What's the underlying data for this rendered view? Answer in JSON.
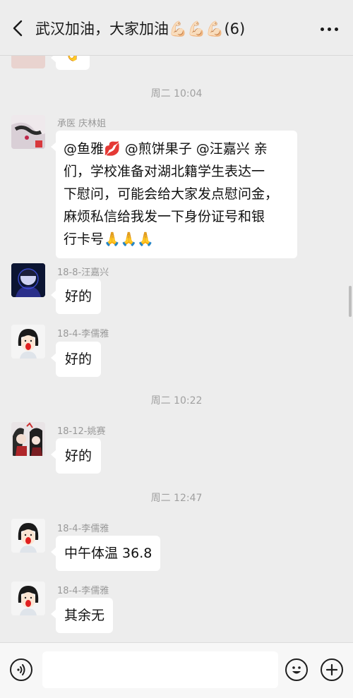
{
  "header": {
    "title": "武汉加油，大家加油💪🏻💪🏻💪🏻(6)"
  },
  "messages": {
    "partial_top": {
      "text": "👌"
    },
    "time1": "周二 10:04",
    "m1": {
      "sender": "承医 庆林姐",
      "line1": "@鱼雅💋 @煎饼果子 @汪嘉兴  亲",
      "line2": "们，学校准备对湖北籍学生表达一",
      "line3": "下慰问，可能会给大家发点慰问金，",
      "line4": "麻烦私信给我发一下身份证号和银",
      "line5": "行卡号🙏🙏🙏"
    },
    "m2": {
      "sender": "18-8-汪嘉兴",
      "text": "好的"
    },
    "m3": {
      "sender": "18-4-李儒雅",
      "text": "好的"
    },
    "time2": "周二 10:22",
    "m4": {
      "sender": "18-12-姚赛",
      "text": "好的"
    },
    "time3": "周二 12:47",
    "m5": {
      "sender": "18-4-李儒雅",
      "text": "中午体温 36.8"
    },
    "m6": {
      "sender": "18-4-李儒雅",
      "text": "其余无"
    }
  },
  "icons": {
    "back": "back-arrow-icon",
    "more": "more-dots-icon",
    "voice": "voice-icon",
    "emoji": "emoji-icon",
    "plus": "plus-icon"
  },
  "colors": {
    "background": "#ededed",
    "bubble": "#ffffff",
    "timestamp": "#a0a0a0"
  }
}
